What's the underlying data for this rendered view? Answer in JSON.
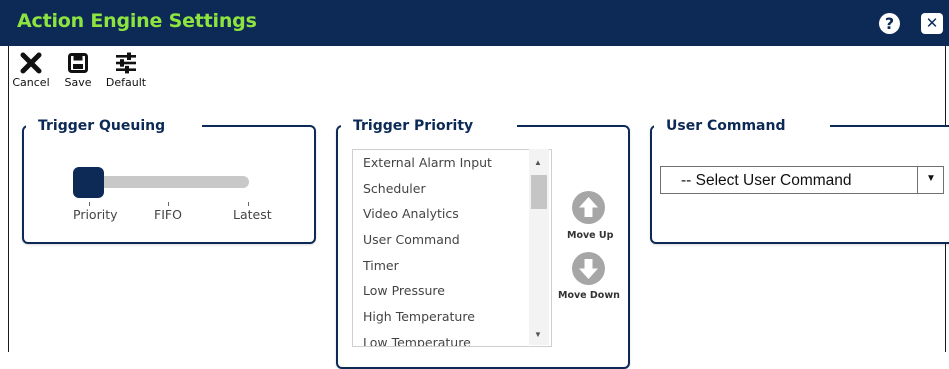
{
  "window": {
    "title": "Action Engine Settings",
    "help_label": "?",
    "close_label": "✕"
  },
  "toolbar": {
    "cancel_label": "Cancel",
    "save_label": "Save",
    "default_label": "Default"
  },
  "trigger_queuing": {
    "title": "Trigger Queuing",
    "options": [
      "Priority",
      "FIFO",
      "Latest"
    ],
    "selected": "Priority"
  },
  "trigger_priority": {
    "title": "Trigger Priority",
    "items": [
      "External Alarm Input",
      "Scheduler",
      "Video Analytics",
      "User Command",
      "Timer",
      "Low Pressure",
      "High Temperature",
      "Low Temperature"
    ],
    "move_up_label": "Move Up",
    "move_down_label": "Move Down"
  },
  "user_command": {
    "title": "User Command",
    "select_value": "-- Select User Command"
  },
  "colors": {
    "header_bg": "#0d2a57",
    "title_text": "#8ee43f",
    "panel_border": "#0d2a57",
    "button_gray": "#a6a6a6"
  },
  "icons": {
    "help": "question-circle-icon",
    "close": "close-icon",
    "cancel": "x-icon",
    "save": "floppy-disk-icon",
    "default": "sliders-icon",
    "move_up": "arrow-up-circle-icon",
    "move_down": "arrow-down-circle-icon"
  }
}
